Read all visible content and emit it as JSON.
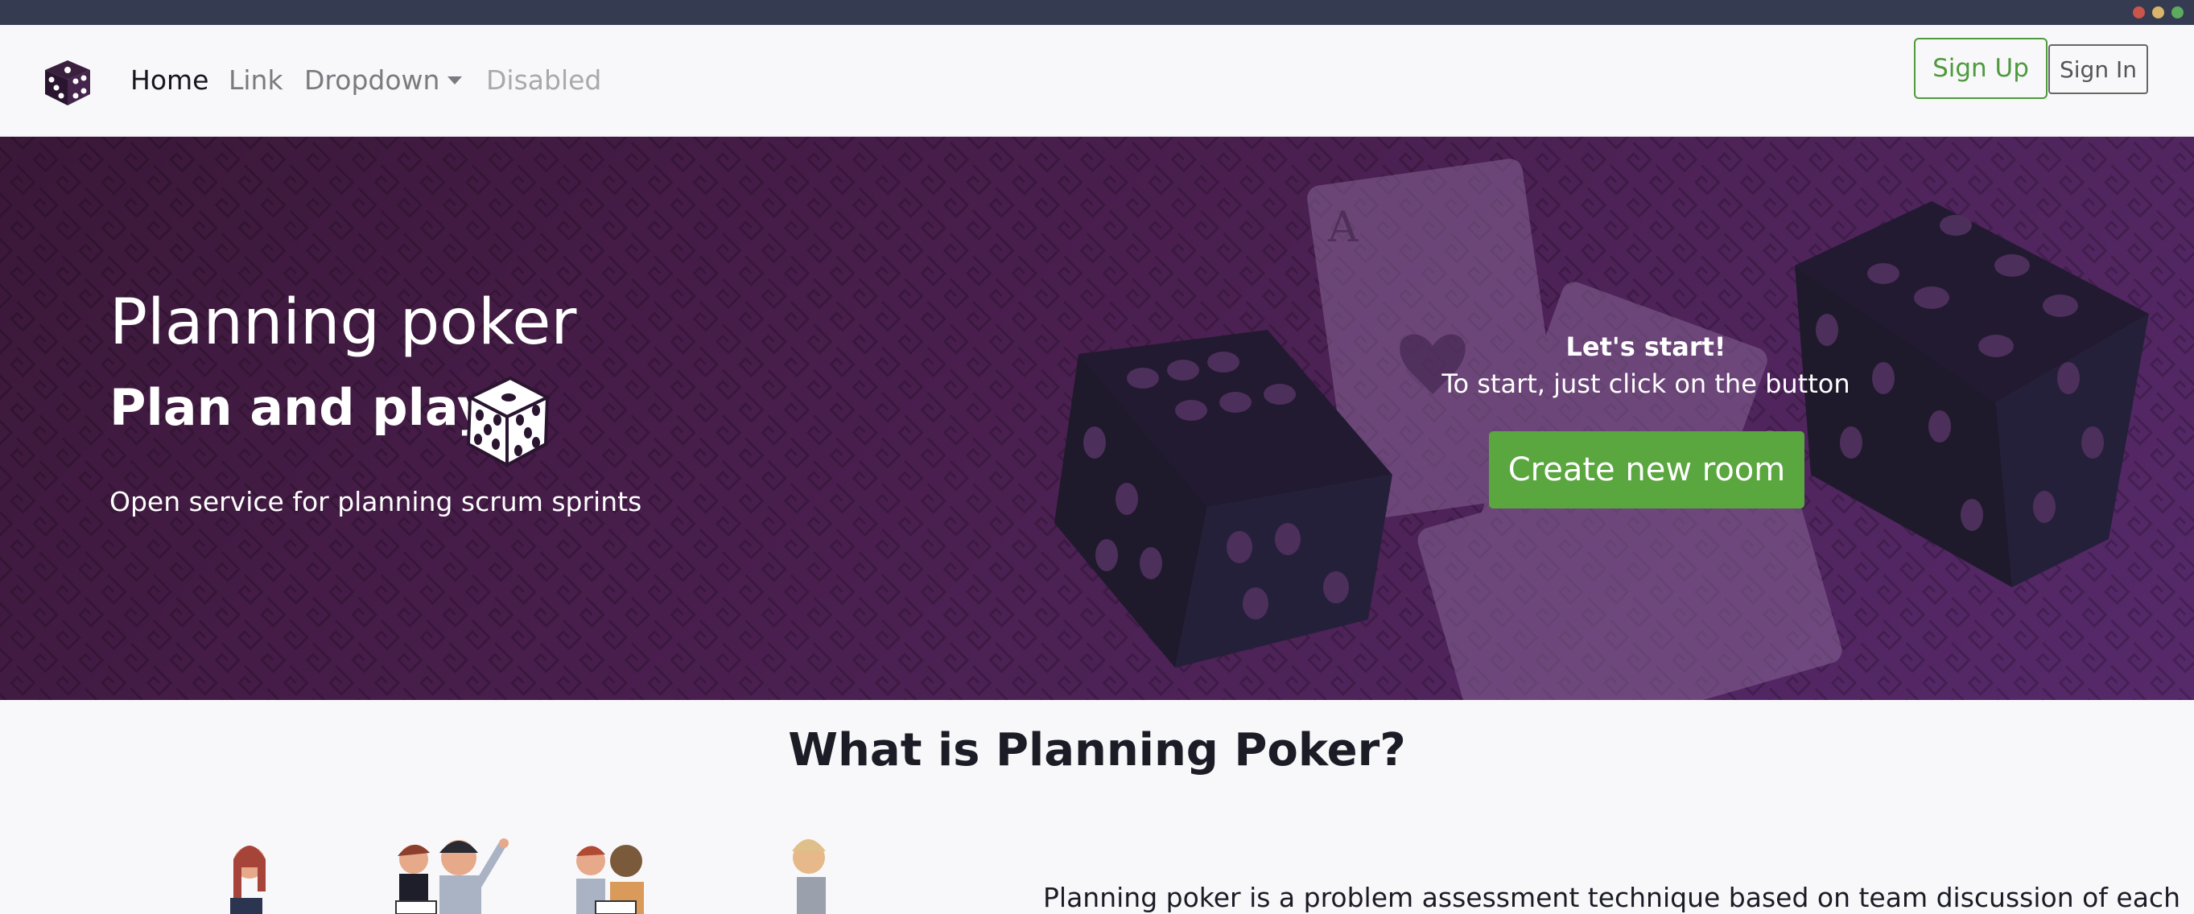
{
  "nav": {
    "brand_icon": "dice-icon",
    "items": [
      {
        "label": "Home",
        "state": "active"
      },
      {
        "label": "Link",
        "state": "normal"
      },
      {
        "label": "Dropdown",
        "state": "normal"
      },
      {
        "label": "Disabled",
        "state": "disabled"
      }
    ],
    "signup_label": "Sign Up",
    "signin_label": "Sign In"
  },
  "hero": {
    "title": "Planning poker",
    "subtitle": "Plan and play!",
    "description": "Open service for planning scrum sprints",
    "cta_heading": "Let's start!",
    "cta_text": "To start, just click on the button",
    "cta_button": "Create new room"
  },
  "section": {
    "title": "What is Planning Poker?",
    "text": "Planning poker is a problem assessment technique based on team discussion of each"
  },
  "colors": {
    "accent_green": "#5aa63f",
    "hero_purple": "#4e2358",
    "chrome": "#353b50"
  }
}
